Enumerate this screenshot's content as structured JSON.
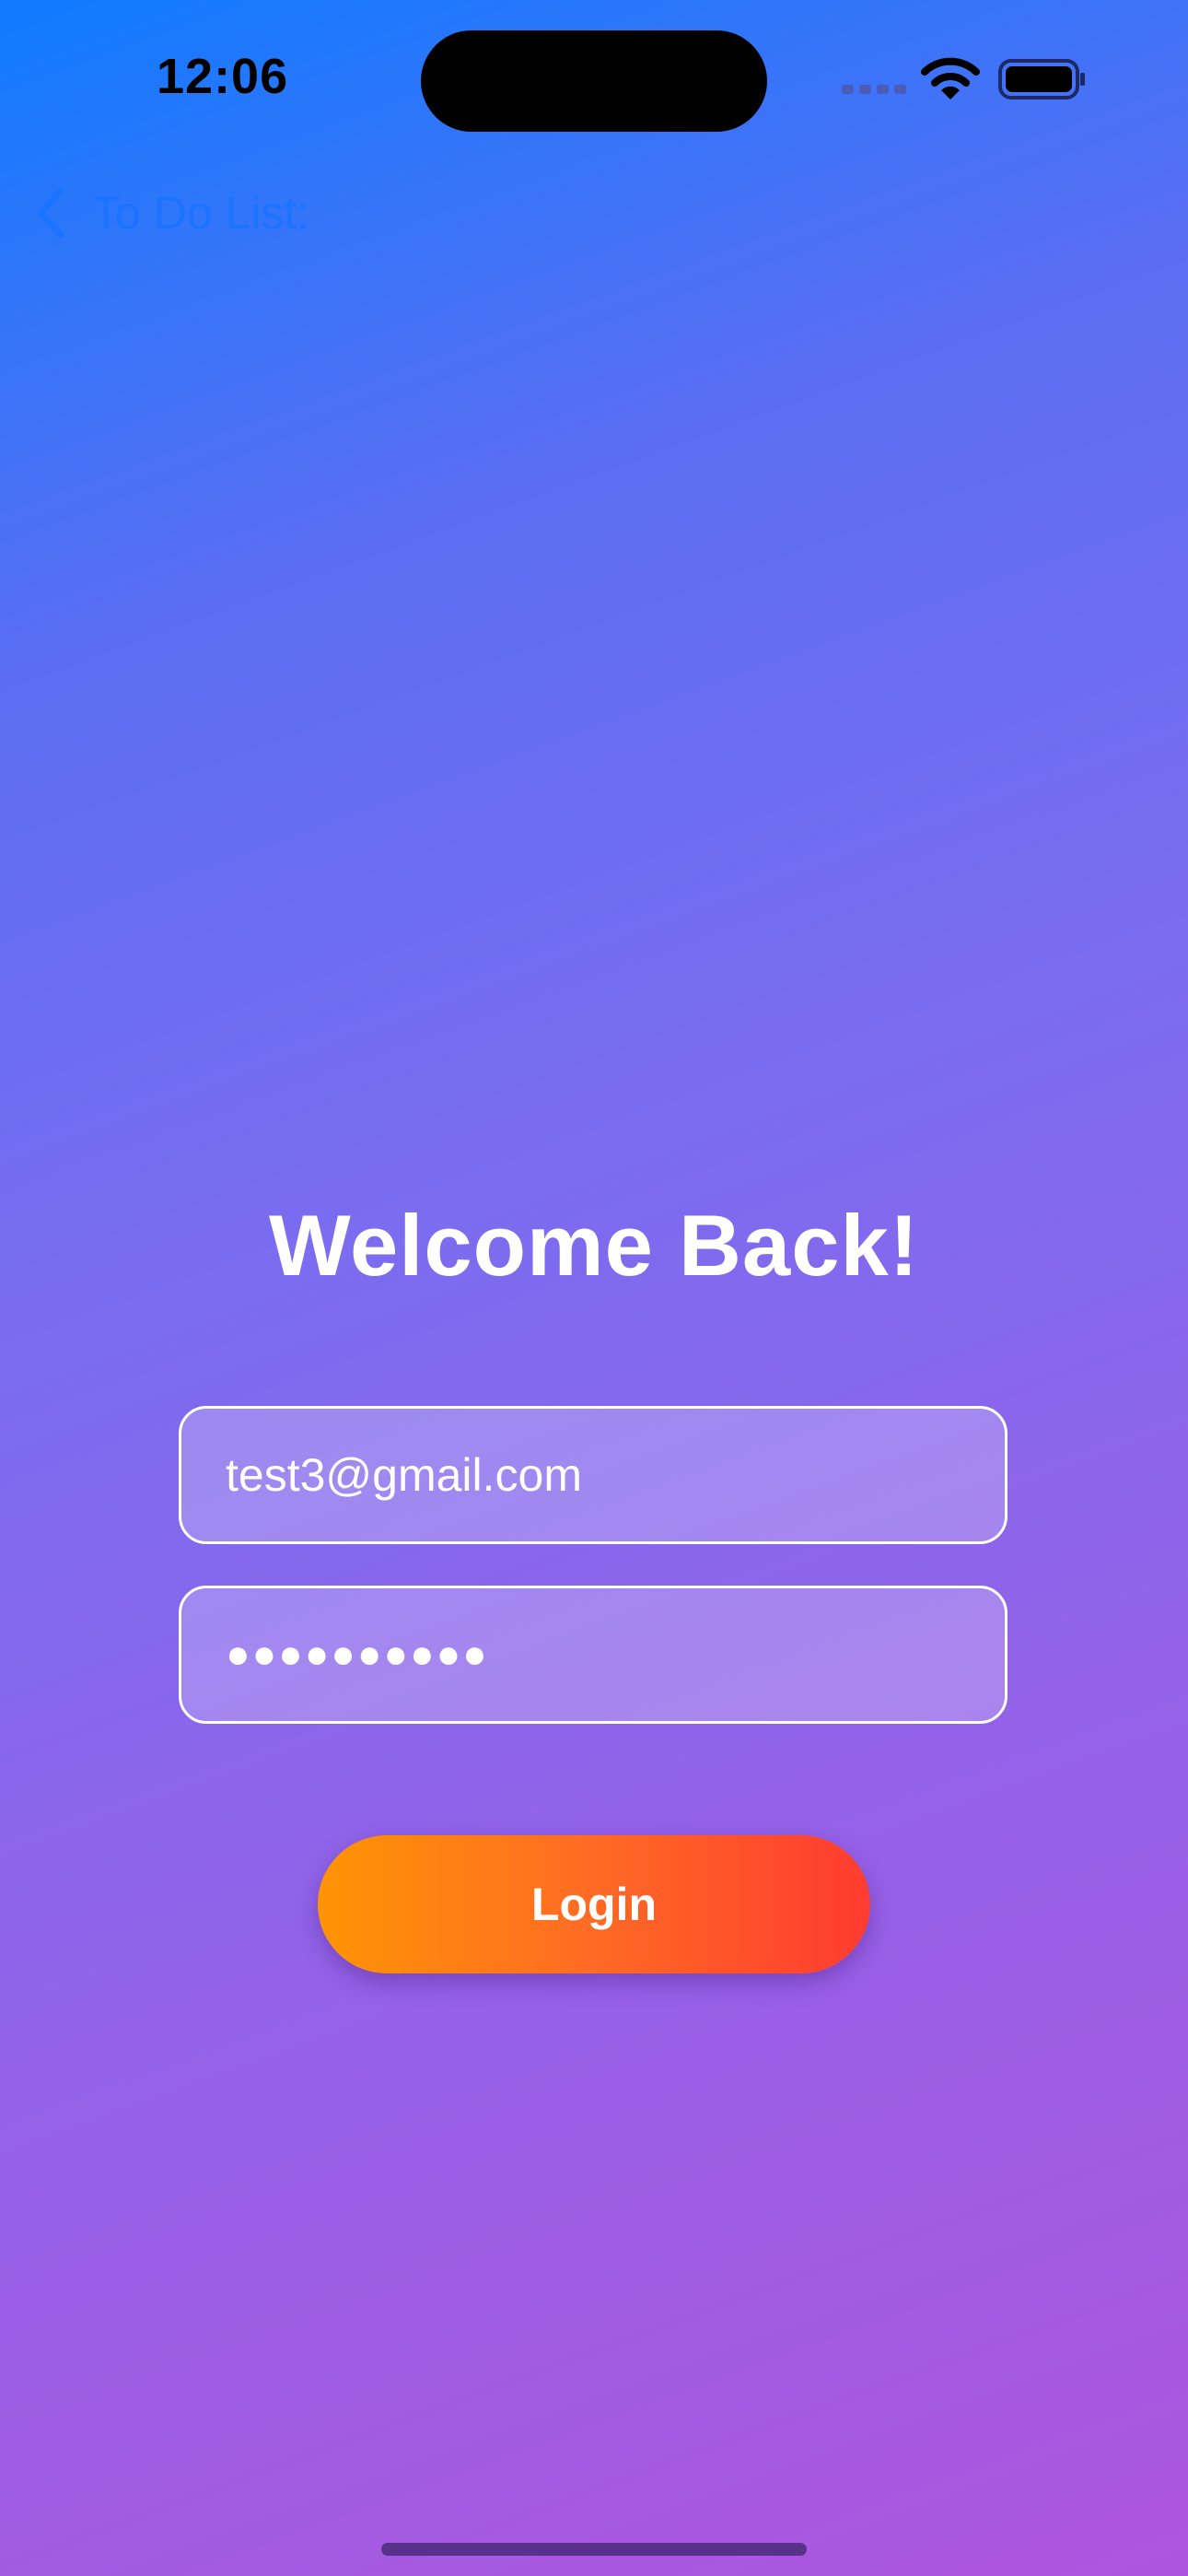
{
  "status_bar": {
    "time": "12:06",
    "icons": [
      "cellular-signal-icon",
      "wifi-icon",
      "battery-icon"
    ]
  },
  "nav": {
    "back_label": "To Do List:",
    "back_icon": "chevron-left-icon"
  },
  "screen": {
    "title": "Welcome Back!"
  },
  "form": {
    "email_value": "test3@gmail.com",
    "password_masked": "●●●●●●●●●●",
    "login_label": "Login"
  },
  "colors": {
    "accent_blue": "#1a74ff",
    "gradient_top": "#0f7bff",
    "gradient_bottom": "#ae55de",
    "button_start": "#ff9405",
    "button_end": "#ff3b30"
  }
}
